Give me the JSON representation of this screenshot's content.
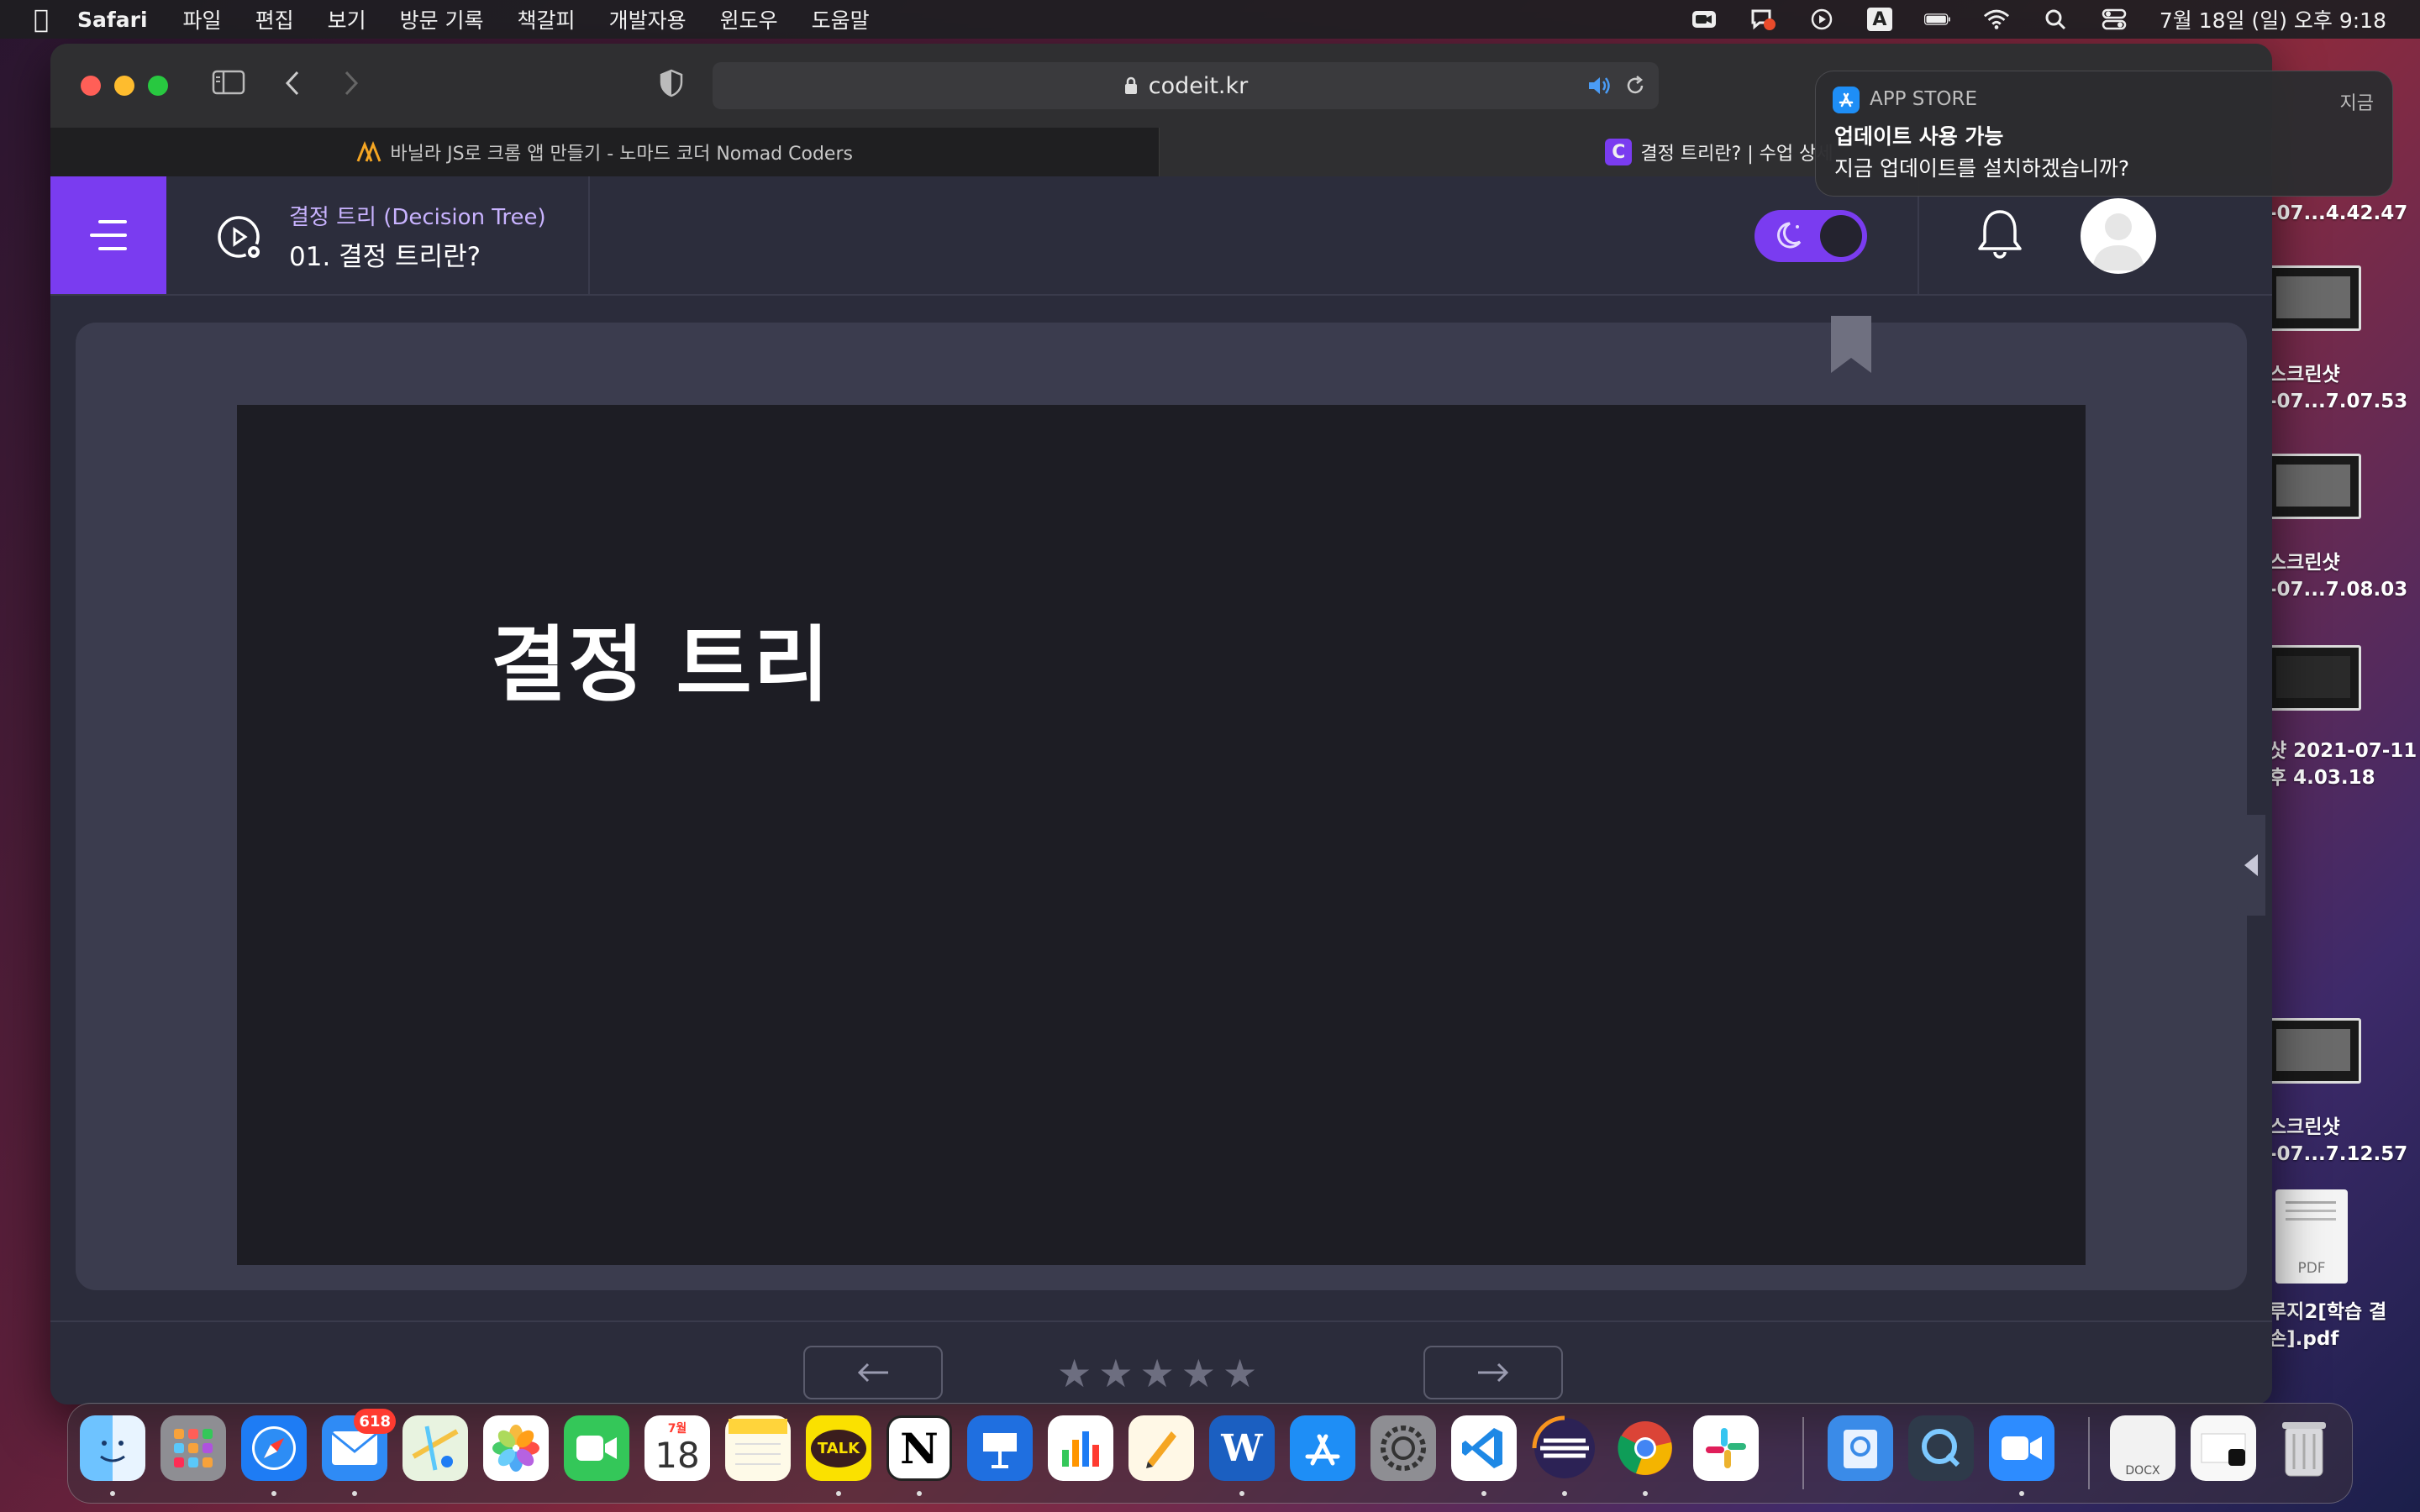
{
  "menubar": {
    "app": "Safari",
    "items": [
      "파일",
      "편집",
      "보기",
      "방문 기록",
      "책갈피",
      "개발자용",
      "윈도우",
      "도움말"
    ],
    "clock": "7월 18일 (일) 오후 9:18",
    "input_indicator": "A"
  },
  "browser": {
    "url": "codeit.kr",
    "tabs": [
      {
        "label": "바닐라 JS로 크롬 앱 만들기 - 노마드 코더 Nomad Coders",
        "active": false
      },
      {
        "label": "결정 트리란? | 수업 상세",
        "active": true
      }
    ]
  },
  "lesson": {
    "chapter": "결정 트리 (Decision Tree)",
    "title": "01. 결정 트리란?",
    "slide_heading": "결정 트리",
    "rating_stars": 5
  },
  "notification": {
    "app": "APP STORE",
    "time": "지금",
    "title": "업데이트 사용 가능",
    "body": "지금 업데이트를 설치하겠습니까?"
  },
  "desktop": {
    "files": [
      {
        "label_1": "-07...4.42.47",
        "label_2": ""
      },
      {
        "label_1": "스크린샷",
        "label_2": "-07...7.07.53"
      },
      {
        "label_1": "스크린샷",
        "label_2": "-07...7.08.03"
      },
      {
        "label_1": "샷 2021-07-11",
        "label_2": "후 4.03.18"
      },
      {
        "label_1": "스크린샷",
        "label_2": "-07...7.12.57"
      },
      {
        "label_1": "루지2[학습 결",
        "label_2": "손].pdf"
      }
    ],
    "pdf_label": "PDF"
  },
  "dock": {
    "mail_badge": "618",
    "calendar_month": "7월",
    "calendar_day": "18",
    "talk_label": "TALK",
    "notion_label": "N",
    "word_label": "W",
    "docx_label": "DOCX"
  }
}
